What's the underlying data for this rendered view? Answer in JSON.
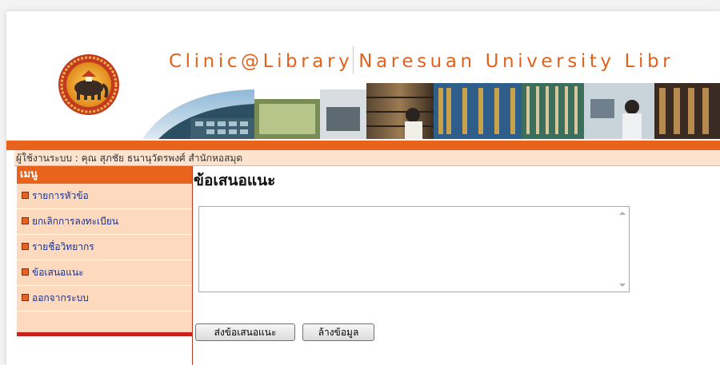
{
  "header": {
    "site_title_left": "Clinic@Library",
    "site_title_right": "Naresuan University Libr",
    "logo_icon": "naresuan-university-seal-icon"
  },
  "user_bar": {
    "text": "ผู้ใช้งานระบบ : คุณ สุภชัย ธนานุวัตรพงศ์ สำนักหอสมุด"
  },
  "sidebar": {
    "header": "เมนู",
    "items": [
      {
        "label": "รายการหัวข้อ"
      },
      {
        "label": "ยกเลิกการลงทะเบียน"
      },
      {
        "label": "รายชื่อวิทยากร"
      },
      {
        "label": "ข้อเสนอแนะ"
      },
      {
        "label": "ออกจากระบบ"
      }
    ]
  },
  "main": {
    "heading": "ข้อเสนอแนะ",
    "textarea_value": "",
    "submit_label": "ส่งข้อเสนอแนะ",
    "clear_label": "ล้างข้อมูล"
  },
  "colors": {
    "accent_orange": "#e8631c",
    "menu_bg": "#fddabd",
    "link_blue": "#1a2f8a",
    "title_orange": "#e2621b",
    "dark_red": "#c8211c"
  }
}
